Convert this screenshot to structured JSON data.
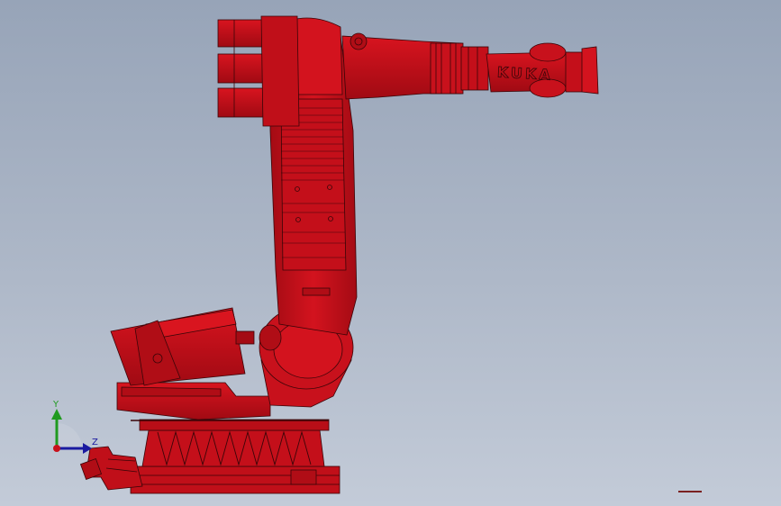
{
  "viewport": {
    "background_top": "#97a4b8",
    "background_bottom": "#c3cbd8"
  },
  "model": {
    "body_color": "#c8111c",
    "shade_color": "#9a0a12",
    "edge_color": "#3a0508",
    "logo_text": "KUKA"
  },
  "triad": {
    "y_label": "Y",
    "z_label": "Z",
    "y_color": "#1f9a1f",
    "z_color": "#1a1aa0",
    "origin_color": "#c8111c"
  }
}
